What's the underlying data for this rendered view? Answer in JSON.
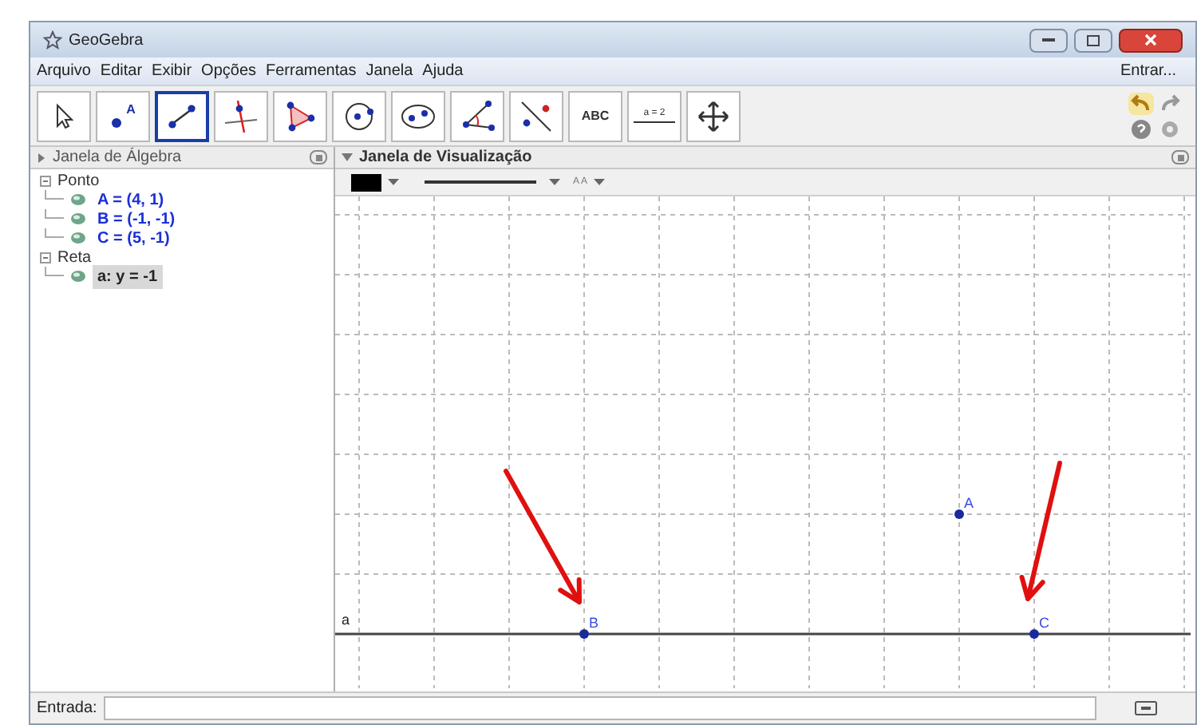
{
  "window": {
    "title": "GeoGebra"
  },
  "menu": [
    "Arquivo",
    "Editar",
    "Exibir",
    "Opções",
    "Ferramentas",
    "Janela",
    "Ajuda"
  ],
  "login": "Entrar...",
  "tools": [
    {
      "kind": "move",
      "selected": false
    },
    {
      "kind": "point",
      "label": "A",
      "selected": false
    },
    {
      "kind": "segment",
      "selected": true
    },
    {
      "kind": "perpendicular",
      "selected": false
    },
    {
      "kind": "polygon",
      "selected": false
    },
    {
      "kind": "circle",
      "selected": false
    },
    {
      "kind": "ellipse",
      "selected": false
    },
    {
      "kind": "angle",
      "selected": false
    },
    {
      "kind": "reflect",
      "selected": false
    },
    {
      "kind": "text",
      "label": "ABC",
      "selected": false
    },
    {
      "kind": "slider",
      "label": "a = 2",
      "selected": false
    },
    {
      "kind": "pan",
      "selected": false
    }
  ],
  "algebra": {
    "title": "Janela de Álgebra",
    "groups": [
      {
        "label": "Ponto",
        "expanded": true,
        "children": [
          {
            "label": "A = (4, 1)",
            "selected": false
          },
          {
            "label": "B = (-1, -1)",
            "selected": false
          },
          {
            "label": "C = (5, -1)",
            "selected": false
          }
        ]
      },
      {
        "label": "Reta",
        "expanded": true,
        "children": [
          {
            "label": "a: y = -1",
            "selected": true
          }
        ]
      }
    ]
  },
  "graphics": {
    "title": "Janela de Visualização",
    "style_bar": {
      "label_style": "A A"
    },
    "points": [
      {
        "label": "A"
      },
      {
        "label": "B"
      },
      {
        "label": "C"
      }
    ],
    "line": {
      "label": "a"
    }
  },
  "input_bar": {
    "label": "Entrada:"
  }
}
